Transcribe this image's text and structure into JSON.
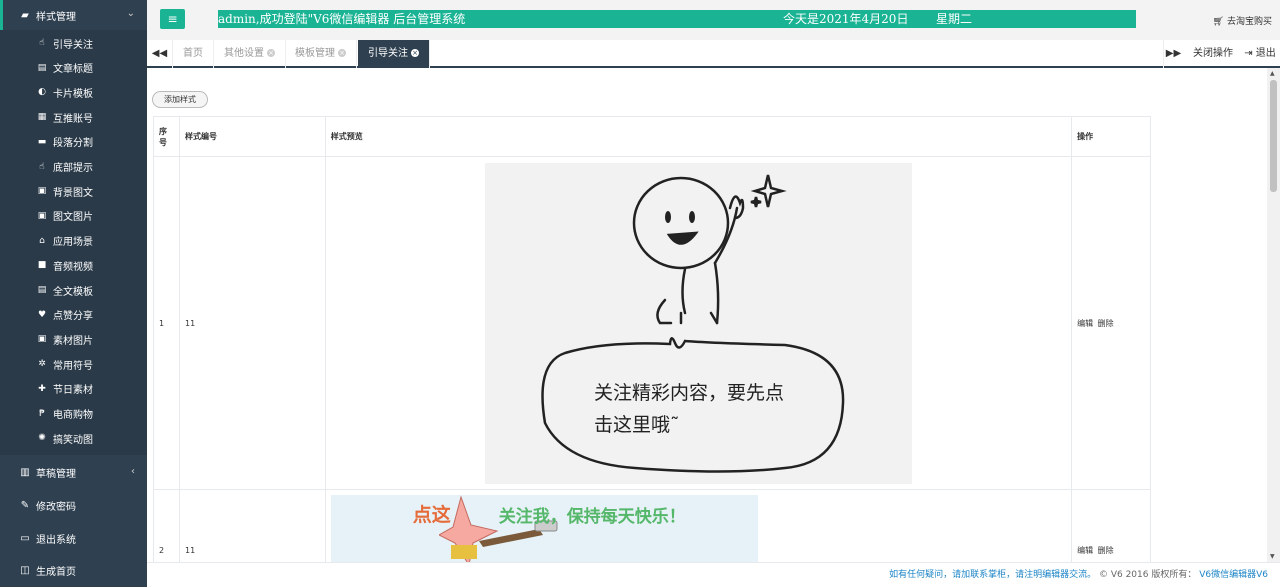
{
  "sidebar": {
    "top_section": {
      "label": "样式管理",
      "icon": "book-icon"
    },
    "items": [
      {
        "label": "引导关注",
        "icon": "pointer-icon"
      },
      {
        "label": "文章标题",
        "icon": "file-icon"
      },
      {
        "label": "卡片模板",
        "icon": "half-circle-icon"
      },
      {
        "label": "互推账号",
        "icon": "barcode-icon"
      },
      {
        "label": "段落分割",
        "icon": "minus-icon"
      },
      {
        "label": "底部提示",
        "icon": "pointer-icon"
      },
      {
        "label": "背景图文",
        "icon": "image-icon"
      },
      {
        "label": "图文图片",
        "icon": "image-icon"
      },
      {
        "label": "应用场景",
        "icon": "home-icon"
      },
      {
        "label": "音频视频",
        "icon": "video-icon"
      },
      {
        "label": "全文模板",
        "icon": "file-icon"
      },
      {
        "label": "点赞分享",
        "icon": "thumbs-up-icon"
      },
      {
        "label": "素材图片",
        "icon": "image-icon"
      },
      {
        "label": "常用符号",
        "icon": "gears-icon"
      },
      {
        "label": "节日素材",
        "icon": "gift-icon"
      },
      {
        "label": "电商购物",
        "icon": "paypal-icon"
      },
      {
        "label": "搞笑动图",
        "icon": "spinner-icon"
      }
    ],
    "sections": [
      {
        "label": "草稿管理",
        "icon": "bar-chart-icon",
        "chevron": "‹"
      },
      {
        "label": "修改密码",
        "icon": "edit-icon"
      },
      {
        "label": "退出系统",
        "icon": "desktop-icon"
      },
      {
        "label": "生成首页",
        "icon": "columns-icon"
      }
    ]
  },
  "header": {
    "banner_left": "admin,成功登陆\"V6微信编辑器 后台管理系统",
    "banner_date": "今天是2021年4月20日",
    "banner_weekday": "星期二",
    "taobao_link": "去淘宝购买"
  },
  "tabs": [
    {
      "label": "首页",
      "closable": false
    },
    {
      "label": "其他设置",
      "closable": true
    },
    {
      "label": "模板管理",
      "closable": true
    },
    {
      "label": "引导关注",
      "closable": true,
      "active": true
    }
  ],
  "tabbar": {
    "close_ops": "关闭操作",
    "logout": "退出"
  },
  "content": {
    "add_button": "添加样式",
    "columns": {
      "index": "序号",
      "code": "样式编号",
      "preview": "样式预览",
      "ops": "操作"
    },
    "rows": [
      {
        "index": "1",
        "code": "11",
        "preview_text_1": "关注精彩内容，要先点",
        "preview_text_2": "击这里哦˜",
        "edit": "编辑",
        "delete": "删除"
      },
      {
        "index": "2",
        "code": "11",
        "preview_text_1": "点这",
        "preview_text_2": "关注我，保持每天快乐！",
        "edit": "编辑",
        "delete": "删除"
      }
    ]
  },
  "footer": {
    "contact": "如有任何疑问，请加联系掌柜，请注明编辑器交流。",
    "copyright": "© V6 2016 版权所有：",
    "brand": "V6微信编辑器V6"
  },
  "colors": {
    "sidebar": "#2f4050",
    "accent": "#1ab394",
    "link": "#1c84c6"
  }
}
